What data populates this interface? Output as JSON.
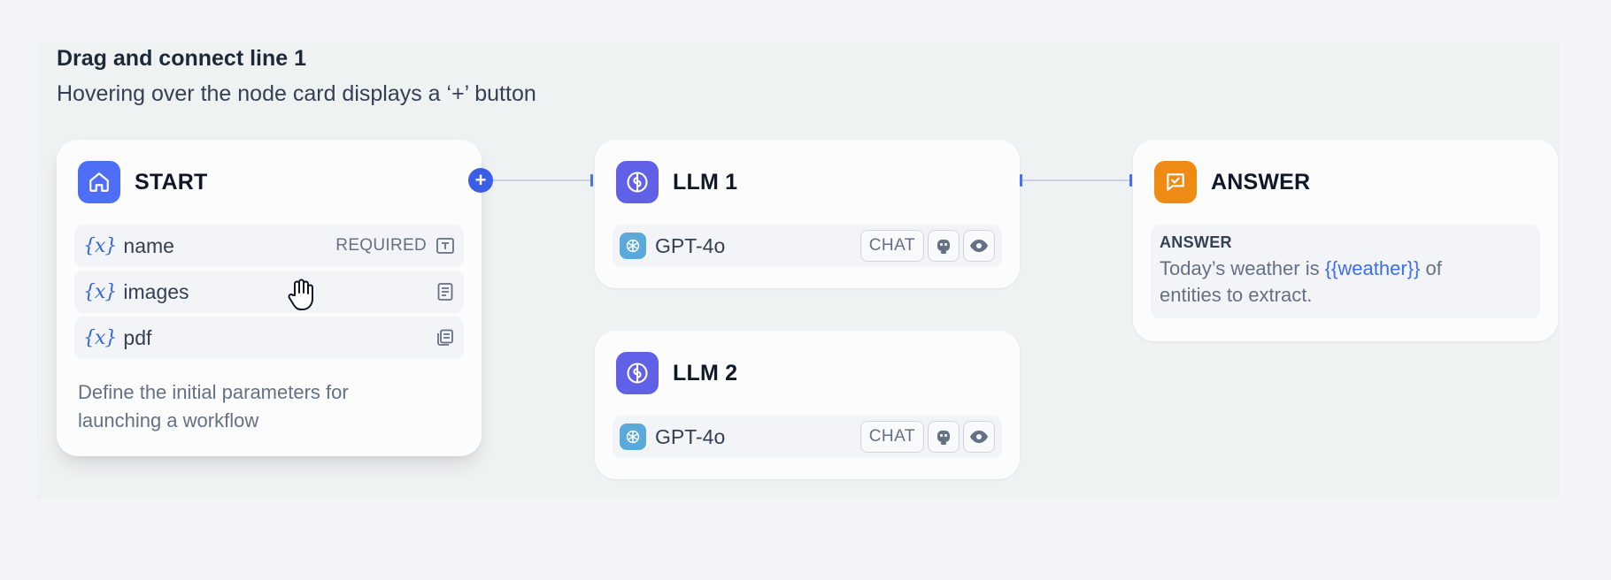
{
  "heading": "Drag and connect line 1",
  "subheading": "Hovering over the node card displays a ‘+’ button",
  "start_node": {
    "title": "START",
    "icon": "home-icon",
    "variables": [
      {
        "symbol": "{x}",
        "name": "name",
        "badge": "REQUIRED",
        "type_icon": "text-input-icon"
      },
      {
        "symbol": "{x}",
        "name": "images",
        "badge": "",
        "type_icon": "document-icon"
      },
      {
        "symbol": "{x}",
        "name": "pdf",
        "badge": "",
        "type_icon": "files-icon"
      }
    ],
    "description": [
      "Define the initial parameters for",
      "launching a workflow"
    ]
  },
  "llm_nodes": [
    {
      "title": "LLM 1",
      "icon": "brain-icon",
      "model": "GPT-4o",
      "mode": "CHAT",
      "capabilities": [
        "robot-icon",
        "eye-icon"
      ]
    },
    {
      "title": "LLM 2",
      "icon": "brain-icon",
      "model": "GPT-4o",
      "mode": "CHAT",
      "capabilities": [
        "robot-icon",
        "eye-icon"
      ]
    }
  ],
  "answer_node": {
    "title": "ANSWER",
    "icon": "message-check-icon",
    "label": "ANSWER",
    "text_before": "Today’s weather is ",
    "text_var": "{{weather}}",
    "text_after": " of",
    "text_line2": "entities to extract."
  },
  "plus_button": "+",
  "colors": {
    "accent": "#4d6ef5",
    "llm_icon": "#6161e8",
    "answer_icon": "#ee8b15",
    "variable": "#3568e0"
  }
}
